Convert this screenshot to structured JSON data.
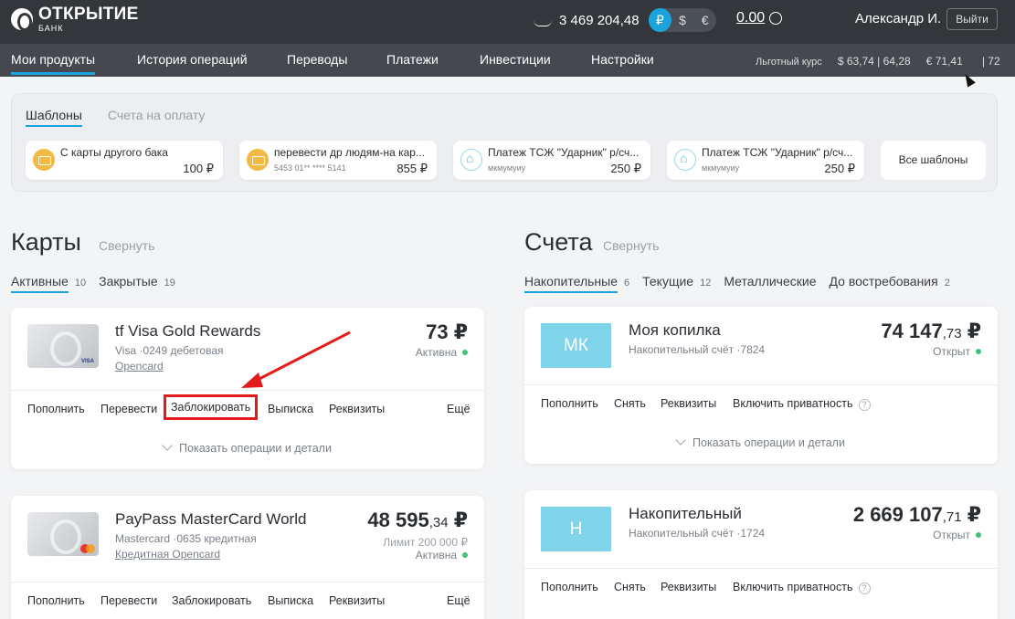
{
  "header": {
    "logo_name": "ОТКРЫТИЕ",
    "logo_sub": "БАНК",
    "balance": "3 469 204,48",
    "currencies": [
      "₽",
      "$",
      "€"
    ],
    "bonus": "0.00",
    "user_name": "Александр И.",
    "logout": "Выйти"
  },
  "nav": {
    "items": [
      "Мои продукты",
      "История операций",
      "Переводы",
      "Платежи",
      "Инвестиции",
      "Настройки"
    ],
    "rates_label": "Льготный курс",
    "rate_usd": "$  63,74 | 64,28",
    "rate_eur": "€  71,41",
    "rate_eur_tail": "| 72"
  },
  "templates": {
    "tabs": [
      "Шаблоны",
      "Счета на оплату"
    ],
    "items": [
      {
        "name": "С карты другого бака",
        "sub": "",
        "amount": "100 ₽",
        "icon": "card-icon"
      },
      {
        "name": "перевести др людям-на кар...",
        "sub": "5453 01** **** 5141",
        "amount": "855 ₽",
        "icon": "card-icon"
      },
      {
        "name": "Платеж ТСЖ \"Ударник\" р/сч...",
        "sub": "мкмумуиу",
        "amount": "250 ₽",
        "icon": "home-icon"
      },
      {
        "name": "Платеж ТСЖ \"Ударник\" р/сч...",
        "sub": "мкмумуиу",
        "amount": "250 ₽",
        "icon": "home-icon"
      }
    ],
    "all_label": "Все шаблоны"
  },
  "cards_section": {
    "title": "Карты",
    "collapse": "Свернуть",
    "tabs": [
      {
        "label": "Активные",
        "count": "10"
      },
      {
        "label": "Закрытые",
        "count": "19"
      }
    ],
    "cards": [
      {
        "name": "tf Visa Gold Rewards",
        "desc": "Visa ·0249 дебетовая",
        "link": "Opencard",
        "amount_int": "73",
        "amount_frac": "",
        "currency": " ₽",
        "limit": "",
        "status": "Активна",
        "brand": "VISA",
        "actions": [
          "Пополнить",
          "Перевести",
          "Заблокировать",
          "Выписка",
          "Реквизиты",
          "Ещё"
        ],
        "details": "Показать операции и детали"
      },
      {
        "name": "PayPass MasterCard World",
        "desc": "Mastercard ·0635 кредитная",
        "link": "Кредитная Opencard",
        "amount_int": "48 595",
        "amount_frac": ",34",
        "currency": " ₽",
        "limit": "Лимит 200 000 ₽",
        "status": "Активна",
        "brand": "mastercard",
        "actions": [
          "Пополнить",
          "Перевести",
          "Заблокировать",
          "Выписка",
          "Реквизиты",
          "Ещё"
        ]
      }
    ]
  },
  "accounts_section": {
    "title": "Счета",
    "collapse": "Свернуть",
    "tabs": [
      {
        "label": "Накопительные",
        "count": "6"
      },
      {
        "label": "Текущие",
        "count": "12"
      },
      {
        "label": "Металлические",
        "count": ""
      },
      {
        "label": "До востребования",
        "count": "2"
      }
    ],
    "accounts": [
      {
        "tile": "МК",
        "name": "Моя копилка",
        "desc": "Накопительный счёт ·7824",
        "amount_int": "74 147",
        "amount_frac": ",73",
        "currency": " ₽",
        "status": "Открыт",
        "actions": [
          "Пополнить",
          "Снять",
          "Реквизиты",
          "Включить приватность"
        ],
        "details": "Показать операции и детали"
      },
      {
        "tile": "Н",
        "name": "Накопительный",
        "desc": "Накопительный счёт ·1724",
        "amount_int": "2 669 107",
        "amount_frac": ",71",
        "currency": " ₽",
        "status": "Открыт",
        "actions": [
          "Пополнить",
          "Снять",
          "Реквизиты",
          "Включить приватность"
        ]
      }
    ]
  },
  "colors": {
    "accent": "#1ca3dc",
    "annotation": "#e41b1b",
    "status_ok": "#3fc27a",
    "tile": "#7fd4ea"
  }
}
